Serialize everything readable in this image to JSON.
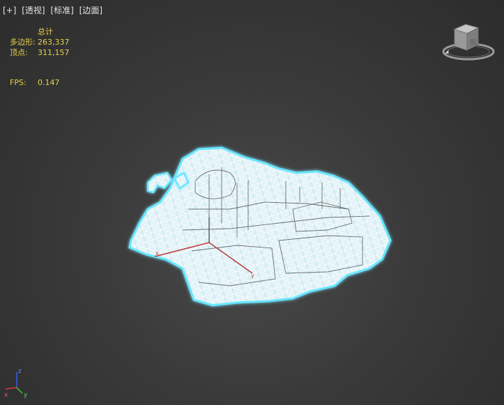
{
  "viewport": {
    "label_plus": "[+]",
    "label_view": "[透视]",
    "label_shading": "[标准]",
    "label_mode": "[边面]"
  },
  "stats": {
    "header": "总计",
    "polygons_label": "多边形:",
    "polygons_value": "263,337",
    "vertices_label": "顶点:",
    "vertices_value": "311,157",
    "fps_label": "FPS:",
    "fps_value": "0.147"
  },
  "viewcube": {
    "face_label": "前"
  },
  "tripod": {
    "z_label": "z",
    "x_label": "x",
    "y_label": "y"
  },
  "colors": {
    "stats_text": "#e8d24a",
    "selection_glow": "#66e6ff",
    "wire": "#e8f2f6"
  }
}
